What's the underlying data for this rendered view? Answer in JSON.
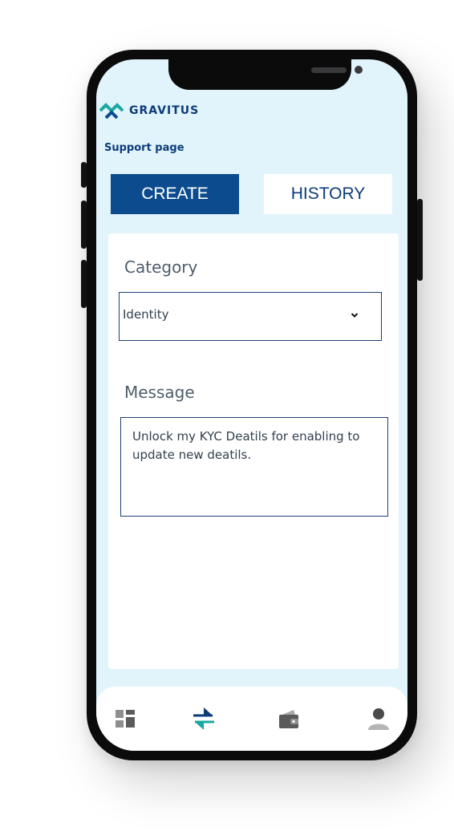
{
  "app": {
    "brand": "GRAVITUS",
    "page_title": "Support page"
  },
  "tabs": [
    {
      "label": "CREATE",
      "active": true
    },
    {
      "label": "HISTORY",
      "active": false
    }
  ],
  "form": {
    "category_label": "Category",
    "category_value": "Identity",
    "message_label": "Message",
    "message_value": "Unlock my KYC Deatils for enabling to update new deatils."
  },
  "bottom_nav": [
    {
      "icon": "dashboard-icon",
      "active": false
    },
    {
      "icon": "transfer-arrows-icon",
      "active": true
    },
    {
      "icon": "wallet-icon",
      "active": false
    },
    {
      "icon": "profile-icon",
      "active": false
    }
  ],
  "colors": {
    "primary": "#0c4b8e",
    "brand_text": "#0c3c78",
    "accent_teal": "#1aa9a0",
    "screen_bg": "#e1f4fb"
  }
}
